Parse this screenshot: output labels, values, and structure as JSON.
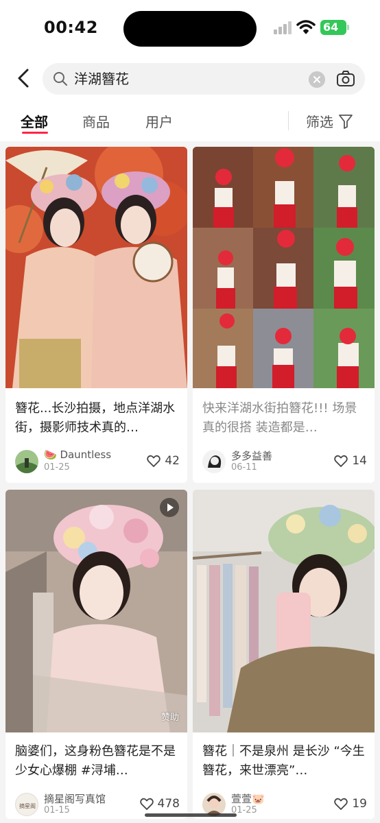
{
  "status_bar": {
    "time": "00:42",
    "battery": "64"
  },
  "search": {
    "query": "洋湖簪花"
  },
  "tabs": [
    {
      "label": "全部"
    },
    {
      "label": "商品"
    },
    {
      "label": "用户"
    }
  ],
  "filter": {
    "label": "筛选"
  },
  "cards": [
    {
      "title": "簪花...长沙拍摄，地点洋湖水街，摄影师技术真的…",
      "author": "🍉 Dauntless",
      "date": "01-25",
      "likes": "42"
    },
    {
      "title": "快来洋湖水街拍簪花!!! 场景真的很搭 装造都是…",
      "author": "多多益善",
      "date": "06-11",
      "likes": "14"
    },
    {
      "title": "脑婆们，这身粉色簪花是不是少女心爆棚 #浔埔…",
      "author": "摘星阁写真馆",
      "date": "01-15",
      "likes": "478",
      "sponsor": "赞助",
      "avatar_text": "摘星阁"
    },
    {
      "title": "簪花｜不是泉州 是长沙 “今生簪花，来世漂亮”…",
      "author": "萱萱🐷",
      "date": "01-25",
      "likes": "19"
    }
  ],
  "colors": {
    "accent": "#ff2442",
    "battery": "#34c759"
  },
  "icons": [
    "back-arrow-icon",
    "search-icon",
    "clear-icon",
    "camera-icon",
    "filter-icon",
    "heart-icon",
    "play-icon",
    "wifi-icon",
    "signal-icon"
  ]
}
